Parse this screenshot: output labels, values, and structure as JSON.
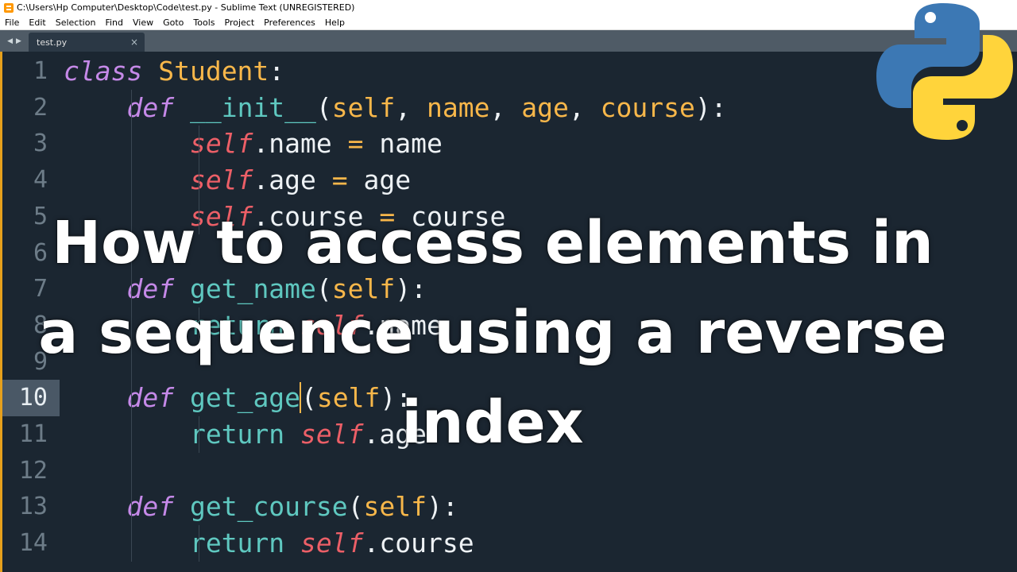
{
  "window": {
    "title": "C:\\Users\\Hp Computer\\Desktop\\Code\\test.py - Sublime Text (UNREGISTERED)"
  },
  "menu": {
    "items": [
      "File",
      "Edit",
      "Selection",
      "Find",
      "View",
      "Goto",
      "Tools",
      "Project",
      "Preferences",
      "Help"
    ]
  },
  "tabs": {
    "nav_left": "◀",
    "nav_right": "▶",
    "active_tab": "test.py",
    "close_glyph": "×"
  },
  "editor": {
    "current_line": 10,
    "lines": [
      {
        "num": "1",
        "tokens": [
          {
            "t": "class",
            "c": "kw"
          },
          {
            "t": " "
          },
          {
            "t": "Student",
            "c": "cls"
          },
          {
            "t": ":"
          }
        ]
      },
      {
        "num": "2",
        "tokens": [
          {
            "t": "    "
          },
          {
            "t": "def",
            "c": "kw"
          },
          {
            "t": " "
          },
          {
            "t": "__init__",
            "c": "fn"
          },
          {
            "t": "("
          },
          {
            "t": "self",
            "c": "param"
          },
          {
            "t": ", "
          },
          {
            "t": "name",
            "c": "param"
          },
          {
            "t": ", "
          },
          {
            "t": "age",
            "c": "param"
          },
          {
            "t": ", "
          },
          {
            "t": "course",
            "c": "param"
          },
          {
            "t": "):"
          }
        ]
      },
      {
        "num": "3",
        "tokens": [
          {
            "t": "        "
          },
          {
            "t": "self",
            "c": "self"
          },
          {
            "t": ".name "
          },
          {
            "t": "=",
            "c": "op"
          },
          {
            "t": " name"
          }
        ]
      },
      {
        "num": "4",
        "tokens": [
          {
            "t": "        "
          },
          {
            "t": "self",
            "c": "self"
          },
          {
            "t": ".age "
          },
          {
            "t": "=",
            "c": "op"
          },
          {
            "t": " age"
          }
        ]
      },
      {
        "num": "5",
        "tokens": [
          {
            "t": "        "
          },
          {
            "t": "self",
            "c": "self"
          },
          {
            "t": ".course "
          },
          {
            "t": "=",
            "c": "op"
          },
          {
            "t": " course"
          }
        ]
      },
      {
        "num": "6",
        "tokens": []
      },
      {
        "num": "7",
        "tokens": [
          {
            "t": "    "
          },
          {
            "t": "def",
            "c": "kw"
          },
          {
            "t": " "
          },
          {
            "t": "get_name",
            "c": "fn"
          },
          {
            "t": "("
          },
          {
            "t": "self",
            "c": "param"
          },
          {
            "t": "):"
          }
        ]
      },
      {
        "num": "8",
        "tokens": [
          {
            "t": "        "
          },
          {
            "t": "return",
            "c": "fn"
          },
          {
            "t": " "
          },
          {
            "t": "self",
            "c": "self"
          },
          {
            "t": ".name"
          }
        ]
      },
      {
        "num": "9",
        "tokens": []
      },
      {
        "num": "10",
        "tokens": [
          {
            "t": "    "
          },
          {
            "t": "def",
            "c": "kw"
          },
          {
            "t": " "
          },
          {
            "t": "get_age",
            "c": "fn"
          },
          {
            "t": "(",
            "c": "caret"
          },
          {
            "t": "self",
            "c": "param"
          },
          {
            "t": "):"
          }
        ]
      },
      {
        "num": "11",
        "tokens": [
          {
            "t": "        "
          },
          {
            "t": "return",
            "c": "fn"
          },
          {
            "t": " "
          },
          {
            "t": "self",
            "c": "self"
          },
          {
            "t": ".age"
          }
        ]
      },
      {
        "num": "12",
        "tokens": []
      },
      {
        "num": "13",
        "tokens": [
          {
            "t": "    "
          },
          {
            "t": "def",
            "c": "kw"
          },
          {
            "t": " "
          },
          {
            "t": "get_course",
            "c": "fn"
          },
          {
            "t": "("
          },
          {
            "t": "self",
            "c": "param"
          },
          {
            "t": "):"
          }
        ]
      },
      {
        "num": "14",
        "tokens": [
          {
            "t": "        "
          },
          {
            "t": "return",
            "c": "fn"
          },
          {
            "t": " "
          },
          {
            "t": "self",
            "c": "self"
          },
          {
            "t": ".course"
          }
        ]
      }
    ]
  },
  "overlay": {
    "title": "How to access elements in a sequence using a reverse index"
  },
  "logo": {
    "icon": "python-logo-icon",
    "blue": "#3c78b4",
    "yellow": "#ffd43b"
  },
  "colors": {
    "background": "#1b2631",
    "keyword": "#c589e8",
    "function": "#5fc8c0",
    "string_param": "#f8b74a",
    "self": "#ec5f67"
  }
}
